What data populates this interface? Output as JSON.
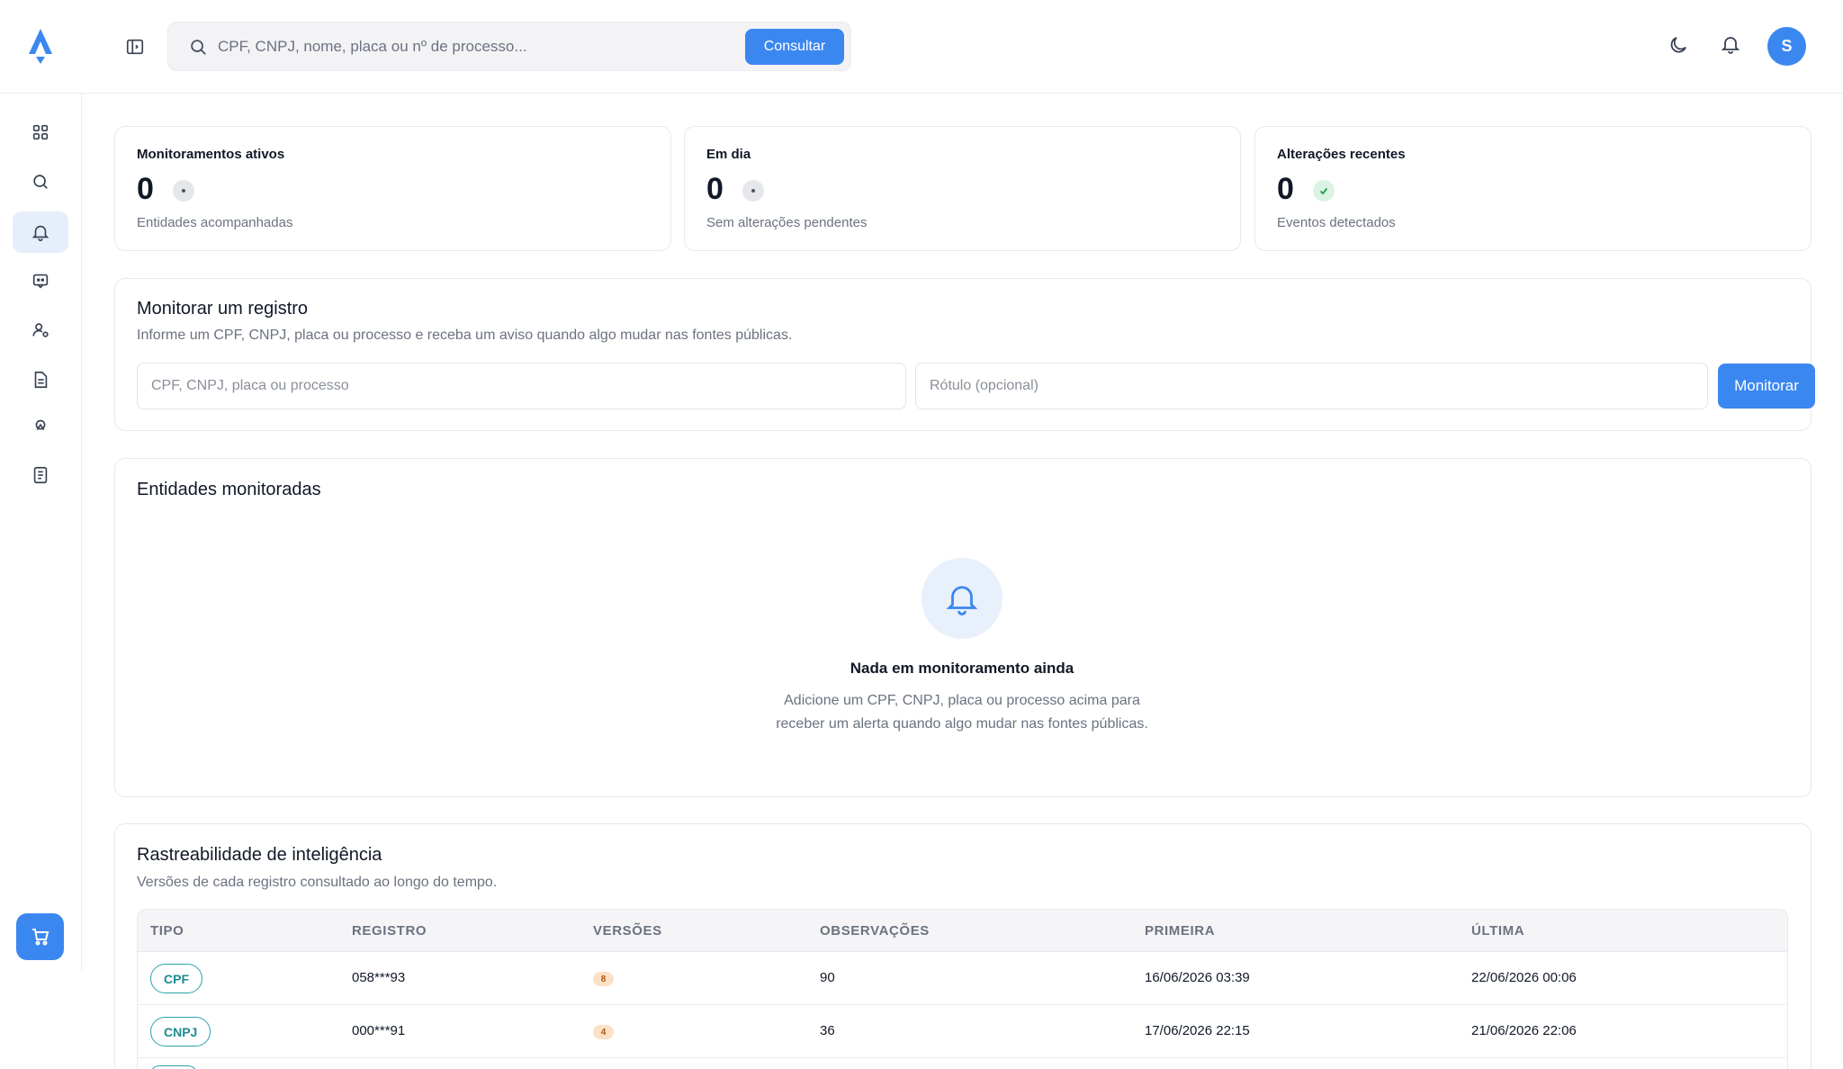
{
  "header": {
    "search_placeholder": "CPF, CNPJ, nome, placa ou nº de processo...",
    "search_button": "Consultar",
    "avatar_initial": "S"
  },
  "sidebar": {
    "items": [
      {
        "name": "dashboard",
        "icon": "grid-icon"
      },
      {
        "name": "search",
        "icon": "search-icon"
      },
      {
        "name": "monitor",
        "icon": "bell-icon",
        "active": true
      },
      {
        "name": "chat",
        "icon": "bot-icon"
      },
      {
        "name": "users",
        "icon": "user-settings-icon"
      },
      {
        "name": "reports",
        "icon": "document-icon"
      },
      {
        "name": "integrations",
        "icon": "webhook-icon"
      },
      {
        "name": "logs",
        "icon": "notes-icon"
      }
    ]
  },
  "stats": [
    {
      "title": "Monitoramentos ativos",
      "value": "0",
      "subtitle": "Entidades acompanhadas",
      "status": "neutral"
    },
    {
      "title": "Em dia",
      "value": "0",
      "subtitle": "Sem alterações pendentes",
      "status": "neutral"
    },
    {
      "title": "Alterações recentes",
      "value": "0",
      "subtitle": "Eventos detectados",
      "status": "ok"
    }
  ],
  "monitor_form": {
    "title": "Monitorar um registro",
    "subtitle": "Informe um CPF, CNPJ, placa ou processo e receba um aviso quando algo mudar nas fontes públicas.",
    "record_placeholder": "CPF, CNPJ, placa ou processo",
    "label_placeholder": "Rótulo (opcional)",
    "button": "Monitorar"
  },
  "monitored": {
    "title": "Entidades monitoradas",
    "empty_title": "Nada em monitoramento ainda",
    "empty_desc_1": "Adicione um CPF, CNPJ, placa ou processo acima para",
    "empty_desc_2": "receber um alerta quando algo mudar nas fontes públicas."
  },
  "traceability": {
    "title": "Rastreabilidade de inteligência",
    "subtitle": "Versões de cada registro consultado ao longo do tempo.",
    "columns": [
      "TIPO",
      "REGISTRO",
      "VERSÕES",
      "OBSERVAÇÕES",
      "PRIMEIRA",
      "ÚLTIMA"
    ],
    "rows": [
      {
        "tipo": "CPF",
        "registro": "058***93",
        "versoes": "8",
        "observacoes": "90",
        "primeira": "16/06/2026 03:39",
        "ultima": "22/06/2026 00:06"
      },
      {
        "tipo": "CNPJ",
        "registro": "000***91",
        "versoes": "4",
        "observacoes": "36",
        "primeira": "17/06/2026 22:15",
        "ultima": "21/06/2026 22:06"
      }
    ]
  },
  "colors": {
    "accent": "#3b87f0",
    "teal": "#2aa3a8"
  }
}
